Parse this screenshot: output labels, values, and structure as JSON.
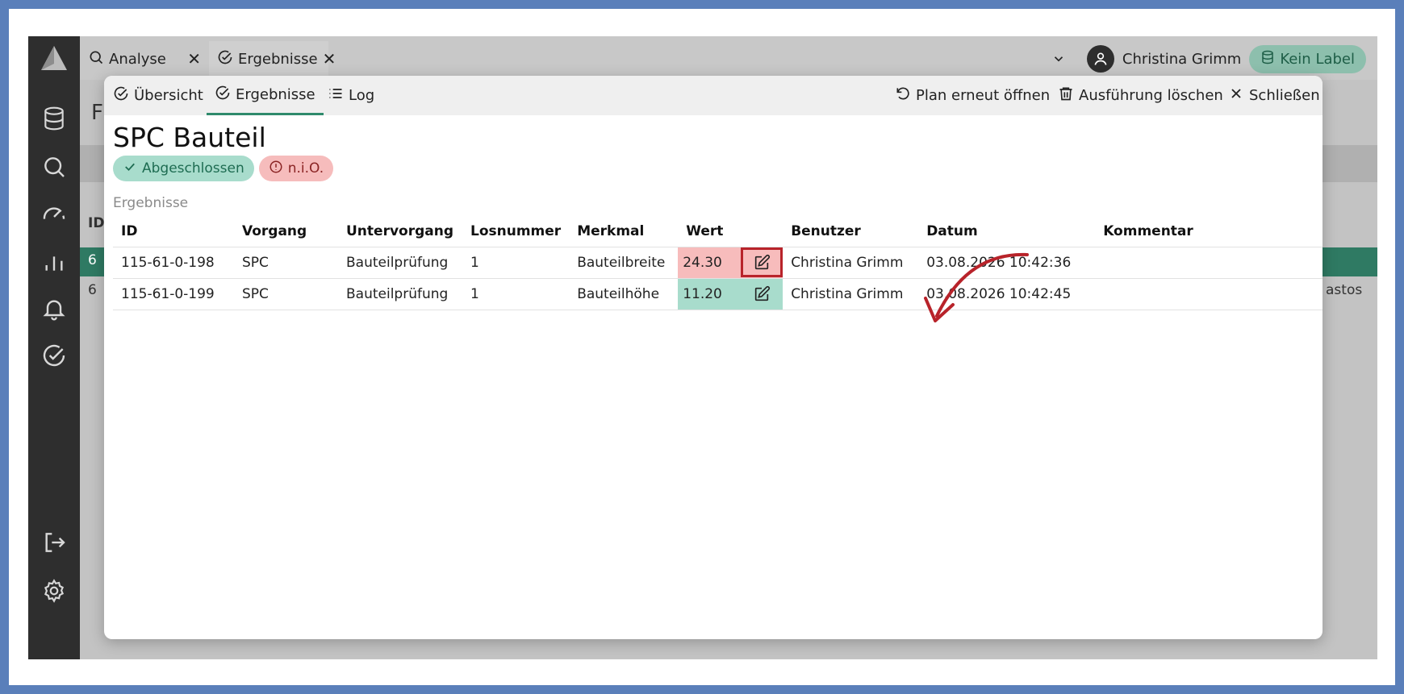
{
  "topbar": {
    "tabs": [
      {
        "label": "Analyse",
        "icon": "search-icon"
      },
      {
        "label": "Ergebnisse",
        "icon": "check-circle-icon"
      }
    ],
    "user_name": "Christina Grimm",
    "label_pill": "Kein Label"
  },
  "background": {
    "page_letter": "F",
    "col_letter": "ID",
    "row_text": "6",
    "row2_text": "6",
    "right_text": "astos"
  },
  "modal": {
    "tabs": [
      {
        "label": "Übersicht"
      },
      {
        "label": "Ergebnisse"
      },
      {
        "label": "Log"
      }
    ],
    "actions": {
      "reopen": "Plan erneut öffnen",
      "delete": "Ausführung löschen",
      "close": "Schließen"
    },
    "title": "SPC Bauteil",
    "badges": {
      "status": "Abgeschlossen",
      "result": "n.i.O."
    },
    "section_label": "Ergebnisse",
    "table": {
      "headers": [
        "ID",
        "Vorgang",
        "Untervorgang",
        "Losnummer",
        "Merkmal",
        "Wert",
        "Benutzer",
        "Datum",
        "Kommentar"
      ],
      "rows": [
        {
          "id": "115-61-0-198",
          "vorgang": "SPC",
          "untervorgang": "Bauteilprüfung",
          "losnummer": "1",
          "merkmal": "Bauteilbreite",
          "wert": "24.30",
          "status": "nio",
          "benutzer": "Christina Grimm",
          "datum": "03.08.2026 10:42:36",
          "kommentar": ""
        },
        {
          "id": "115-61-0-199",
          "vorgang": "SPC",
          "untervorgang": "Bauteilprüfung",
          "losnummer": "1",
          "merkmal": "Bauteilhöhe",
          "wert": "11.20",
          "status": "io",
          "benutzer": "Christina Grimm",
          "datum": "03.08.2026 10:42:45",
          "kommentar": ""
        }
      ]
    }
  },
  "colors": {
    "accent": "#2f8a6c",
    "nio_bg": "#f7bcbc",
    "io_bg": "#a8dccc",
    "highlight": "#b8232a"
  }
}
